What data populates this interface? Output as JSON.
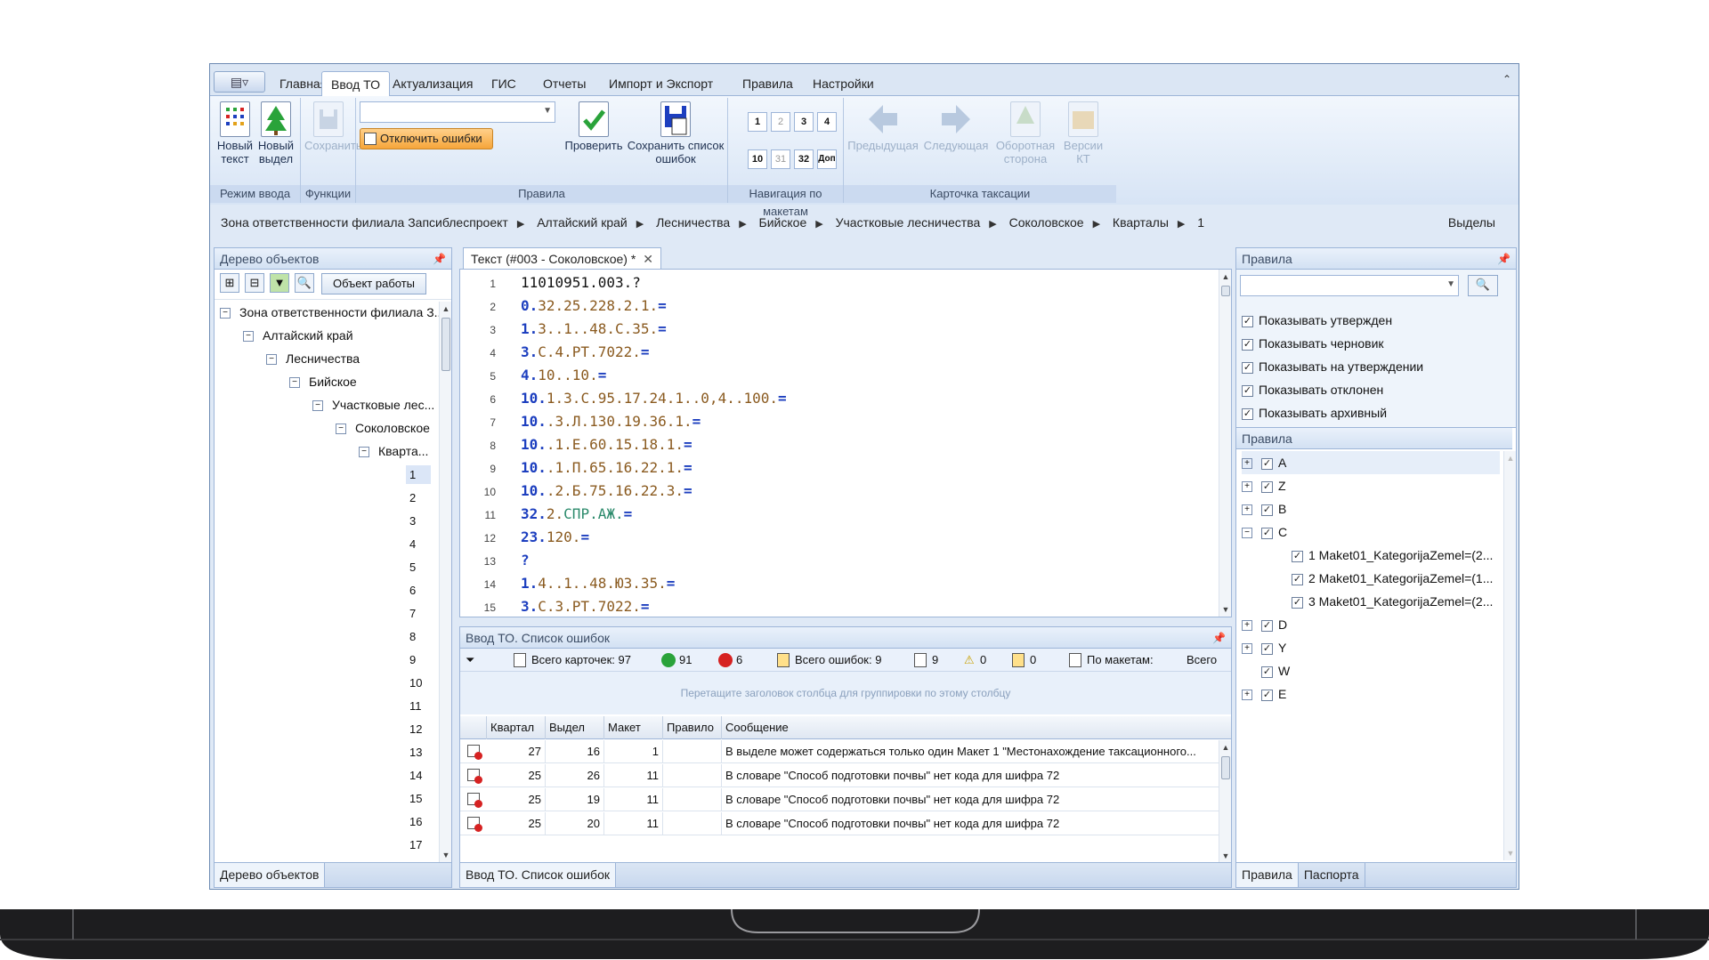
{
  "ribbon": {
    "app_menu_icon": "app-menu-icon",
    "tabs": [
      "Главная",
      "Ввод ТО",
      "Актуализация",
      "ГИС",
      "Отчеты",
      "Импорт и Экспорт",
      "Правила",
      "Настройки"
    ],
    "active_tab": "Ввод ТО",
    "groups": {
      "mode": {
        "label": "Режим ввода",
        "new_text": "Новый текст",
        "new_plot": "Новый выдел"
      },
      "functions": {
        "label": "Функции",
        "save": "Сохранить"
      },
      "rules": {
        "label": "Правила",
        "disable_errors": "Отключить ошибки",
        "check": "Проверить",
        "save_error_list": "Сохранить список ошибок"
      },
      "nav": {
        "label": "Навигация по макетам",
        "row1": [
          "1",
          "2",
          "3",
          "4"
        ],
        "row2": [
          "10",
          "31",
          "32",
          "Доп"
        ]
      },
      "card": {
        "label": "Карточка таксации",
        "prev": "Предыдущая",
        "next": "Следующая",
        "back_side": "Оборотная сторона",
        "versions": "Версии КТ"
      }
    }
  },
  "breadcrumb": {
    "items": [
      "Зона ответственности филиала Запсиблеспроект",
      "Алтайский край",
      "Лесничества",
      "Бийское",
      "Участковые лесничества",
      "Соколовское",
      "Кварталы",
      "1"
    ],
    "right": "Выделы"
  },
  "object_tree": {
    "title": "Дерево объектов",
    "work_object_button": "Объект работы",
    "nodes": [
      "Зона ответственности филиала З...",
      "Алтайский край",
      "Лесничества",
      "Бийское",
      "Участковые лес...",
      "Соколовское",
      "Кварта..."
    ],
    "numbers": [
      "1",
      "2",
      "3",
      "4",
      "5",
      "6",
      "7",
      "8",
      "9",
      "10",
      "11",
      "12",
      "13",
      "14",
      "15",
      "16",
      "17"
    ],
    "footer_tab": "Дерево объектов"
  },
  "editor": {
    "tab_title": "Текст (#003 - Соколовское) *",
    "lines": [
      {
        "n": "1",
        "parts": [
          {
            "t": "11010951.003.?",
            "c": "plain"
          }
        ]
      },
      {
        "n": "2",
        "parts": [
          {
            "t": "0.",
            "c": "blue"
          },
          {
            "t": "32.25.228.2.1.",
            "c": "brown"
          },
          {
            "t": "=",
            "c": "blue"
          }
        ]
      },
      {
        "n": "3",
        "parts": [
          {
            "t": "1.",
            "c": "blue"
          },
          {
            "t": "3..1..48.С.35.",
            "c": "brown"
          },
          {
            "t": "=",
            "c": "blue"
          }
        ]
      },
      {
        "n": "4",
        "parts": [
          {
            "t": "3.",
            "c": "blue"
          },
          {
            "t": "С.4.РТ.7022.",
            "c": "brown"
          },
          {
            "t": "=",
            "c": "blue"
          }
        ]
      },
      {
        "n": "5",
        "parts": [
          {
            "t": "4.",
            "c": "blue"
          },
          {
            "t": "10..10.",
            "c": "brown"
          },
          {
            "t": "=",
            "c": "blue"
          }
        ]
      },
      {
        "n": "6",
        "parts": [
          {
            "t": "10.",
            "c": "blue"
          },
          {
            "t": "1.3.С.95.17.24.1..0,4..100.",
            "c": "brown"
          },
          {
            "t": "=",
            "c": "blue"
          }
        ]
      },
      {
        "n": "7",
        "parts": [
          {
            "t": "10.",
            "c": "blue"
          },
          {
            "t": ".3.Л.130.19.36.1.",
            "c": "brown"
          },
          {
            "t": "=",
            "c": "blue"
          }
        ]
      },
      {
        "n": "8",
        "parts": [
          {
            "t": "10.",
            "c": "blue"
          },
          {
            "t": ".1.Е.60.15.18.1.",
            "c": "brown"
          },
          {
            "t": "=",
            "c": "blue"
          }
        ]
      },
      {
        "n": "9",
        "parts": [
          {
            "t": "10.",
            "c": "blue"
          },
          {
            "t": ".1.П.65.16.22.1.",
            "c": "brown"
          },
          {
            "t": "=",
            "c": "blue"
          }
        ]
      },
      {
        "n": "10",
        "parts": [
          {
            "t": "10.",
            "c": "blue"
          },
          {
            "t": ".2.Б.75.16.22.3.",
            "c": "brown"
          },
          {
            "t": "=",
            "c": "blue"
          }
        ]
      },
      {
        "n": "11",
        "parts": [
          {
            "t": "32.",
            "c": "blue"
          },
          {
            "t": "2.",
            "c": "brown"
          },
          {
            "t": "СПР.АЖ.",
            "c": "teal"
          },
          {
            "t": "=",
            "c": "blue"
          }
        ]
      },
      {
        "n": "12",
        "parts": [
          {
            "t": "23.",
            "c": "blue"
          },
          {
            "t": "120.",
            "c": "brown"
          },
          {
            "t": "=",
            "c": "blue"
          }
        ]
      },
      {
        "n": "13",
        "parts": [
          {
            "t": "?",
            "c": "blue"
          }
        ]
      },
      {
        "n": "14",
        "parts": [
          {
            "t": "1.",
            "c": "blue"
          },
          {
            "t": "4..1..48.ЮЗ.35.",
            "c": "brown"
          },
          {
            "t": "=",
            "c": "blue"
          }
        ]
      },
      {
        "n": "15",
        "parts": [
          {
            "t": "3.",
            "c": "blue"
          },
          {
            "t": "С.3.РТ.7022.",
            "c": "brown"
          },
          {
            "t": "=",
            "c": "blue"
          }
        ]
      }
    ]
  },
  "errors": {
    "title": "Ввод ТО. Список ошибок",
    "toolbar": {
      "total_cards": "Всего карточек: 97",
      "ok_count": "91",
      "err_count": "6",
      "total_errors": "Всего ошибок: 9",
      "err_cards": "9",
      "warn_count": "0",
      "warn_cards": "0",
      "by_layouts": "По макетам:",
      "all": "Всего"
    },
    "group_hint": "Перетащите заголовок столбца для группировки по этому столбцу",
    "columns": [
      "Квартал",
      "Выдел",
      "Макет",
      "Правило",
      "Сообщение"
    ],
    "rows": [
      {
        "kv": "27",
        "vd": "16",
        "mk": "1",
        "pr": "",
        "msg": "В выделе может содержаться только один Макет 1 \"Местонахождение таксационного..."
      },
      {
        "kv": "25",
        "vd": "26",
        "mk": "11",
        "pr": "",
        "msg": "В словаре \"Способ подготовки почвы\" нет кода для шифра 72"
      },
      {
        "kv": "25",
        "vd": "19",
        "mk": "11",
        "pr": "",
        "msg": "В словаре \"Способ подготовки почвы\" нет кода для шифра 72"
      },
      {
        "kv": "25",
        "vd": "20",
        "mk": "11",
        "pr": "",
        "msg": "В словаре \"Способ подготовки почвы\" нет кода для шифра 72"
      }
    ],
    "footer_tab": "Ввод ТО. Список ошибок"
  },
  "rules_panel": {
    "title": "Правила",
    "filters": [
      "Показывать утвержден",
      "Показывать черновик",
      "Показывать на утверждении",
      "Показывать отклонен",
      "Показывать архивный"
    ],
    "tree_header": "Правила",
    "groups": [
      {
        "name": "A",
        "expanded": false
      },
      {
        "name": "Z",
        "expanded": false
      },
      {
        "name": "B",
        "expanded": false
      },
      {
        "name": "C",
        "expanded": true,
        "children": [
          "1 Maket01_KategorijaZemel=(2...",
          "2 Maket01_KategorijaZemel=(1...",
          "3 Maket01_KategorijaZemel=(2..."
        ]
      },
      {
        "name": "D",
        "expanded": false
      },
      {
        "name": "Y",
        "expanded": false
      },
      {
        "name": "W",
        "expanded": false
      },
      {
        "name": "E",
        "expanded": false
      }
    ],
    "footer_tabs": [
      "Правила",
      "Паспорта"
    ]
  },
  "colors": {
    "accent": "#f6a53a",
    "ribbon": "#dbe6f4",
    "code_blue": "#1d3fbf",
    "code_brown": "#8a5a1f",
    "error_red": "#d62222",
    "ok_green": "#2aa33a"
  }
}
